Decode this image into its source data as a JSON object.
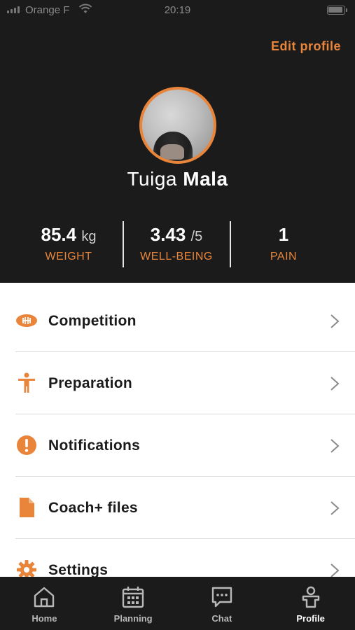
{
  "status_bar": {
    "carrier": "Orange F",
    "time": "20:19"
  },
  "header": {
    "edit_profile_label": "Edit profile"
  },
  "profile": {
    "first_name": "Tuiga",
    "last_name": "Mala"
  },
  "stats": [
    {
      "value": "85.4",
      "unit": "kg",
      "label": "WEIGHT"
    },
    {
      "value": "3.43",
      "unit": "/5",
      "label": "WELL-BEING"
    },
    {
      "value": "1",
      "unit": "",
      "label": "PAIN"
    }
  ],
  "menu": {
    "items": [
      {
        "label": "Competition",
        "icon": "rugby-ball-icon"
      },
      {
        "label": "Preparation",
        "icon": "person-icon"
      },
      {
        "label": "Notifications",
        "icon": "exclamation-icon"
      },
      {
        "label": "Coach+ files",
        "icon": "file-icon"
      },
      {
        "label": "Settings",
        "icon": "gear-icon"
      }
    ]
  },
  "tab_bar": {
    "tabs": [
      {
        "label": "Home",
        "icon": "home-icon",
        "active": false
      },
      {
        "label": "Planning",
        "icon": "calendar-icon",
        "active": false
      },
      {
        "label": "Chat",
        "icon": "chat-icon",
        "active": false
      },
      {
        "label": "Profile",
        "icon": "profile-icon",
        "active": true
      }
    ]
  },
  "colors": {
    "accent": "#e9853a",
    "background_dark": "#1b1b1b",
    "menu_background": "#ffffff",
    "divider": "#dcdcdc"
  }
}
